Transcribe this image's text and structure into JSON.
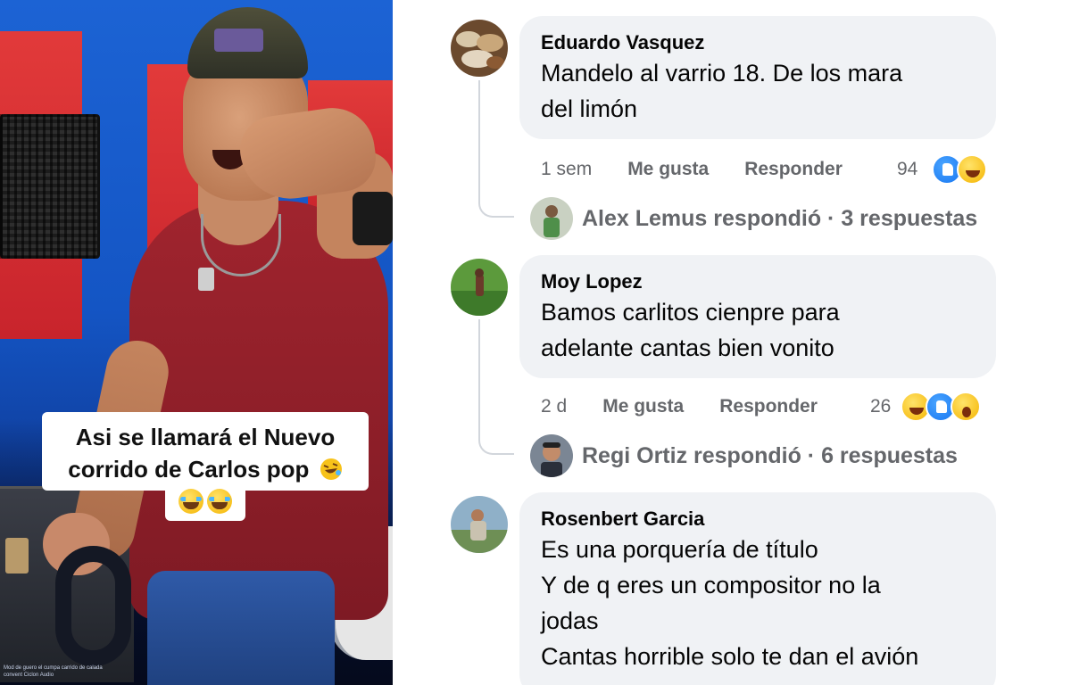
{
  "video": {
    "caption_line1": "Asi se llamará el Nuevo",
    "caption_line2": "corrido de Carlos pop",
    "caption_emoji_icon": "rolling-on-floor-laughing-icon",
    "caption_emoji_row_icon": "face-with-tears-of-joy-icon",
    "credit": "Mod de guero el cumpa carrido de calada\nconvent Ciclon Audio"
  },
  "comments": [
    {
      "author": "Eduardo Vasquez",
      "text_lines": [
        "Mandelo al varrio 18. De los mara",
        "del limón"
      ],
      "time": "1 sem",
      "like_label": "Me gusta",
      "reply_label": "Responder",
      "reaction_count": "94",
      "reactions": [
        "like",
        "haha"
      ],
      "replies": {
        "author": "Alex Lemus",
        "summary": "Alex Lemus respondió · 3 respuestas"
      }
    },
    {
      "author": "Moy Lopez",
      "text_lines": [
        "Bamos carlitos cienpre para",
        "adelante cantas bien vonito"
      ],
      "time": "2 d",
      "like_label": "Me gusta",
      "reply_label": "Responder",
      "reaction_count": "26",
      "reactions": [
        "haha",
        "like",
        "wow"
      ],
      "replies": {
        "author": "Regi Ortiz",
        "summary": "Regi Ortiz respondió · 6 respuestas"
      }
    },
    {
      "author": "Rosenbert Garcia",
      "text_lines": [
        "Es una porquería de título",
        "Y de q eres un compositor no la",
        "jodas",
        "Cantas horrible solo te dan el avión"
      ]
    }
  ],
  "colors": {
    "bubble_bg": "#f0f2f5",
    "meta_text": "#65676b",
    "like_blue": "#1877f2",
    "haha_yellow": "#f5b400"
  }
}
